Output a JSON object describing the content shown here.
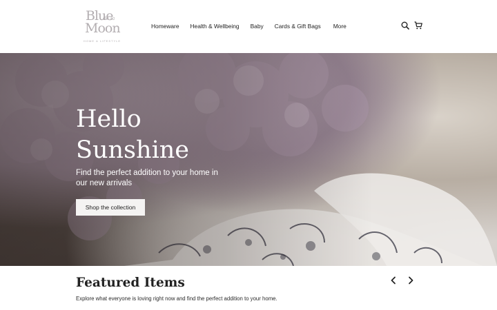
{
  "header": {
    "logo": {
      "word_top": "Blue",
      "word_tiny": "de la",
      "word_bottom": "Moon",
      "tagline": "HOME & LIFESTYLE"
    },
    "nav": [
      {
        "label": "Homeware"
      },
      {
        "label": "Health & Wellbeing"
      },
      {
        "label": "Baby"
      },
      {
        "label": "Cards & Gift Bags"
      },
      {
        "label": "More"
      }
    ],
    "icons": {
      "search": "search-icon",
      "cart": "cart-icon"
    }
  },
  "hero": {
    "title_line1": "Hello",
    "title_line2": "Sunshine",
    "subtitle": "Find the perfect addition to your home in our new arrivals",
    "cta_label": "Shop the collection"
  },
  "featured": {
    "title": "Featured Items",
    "description": "Explore what everyone is loving right now and find the perfect addition to your home.",
    "prev_icon": "chevron-left-icon",
    "next_icon": "chevron-right-icon"
  },
  "colors": {
    "text": "#1e1e1e",
    "logo": "#b3aeb1",
    "hero_button_bg": "#f4f3f2",
    "hero_text": "#ffffff"
  }
}
